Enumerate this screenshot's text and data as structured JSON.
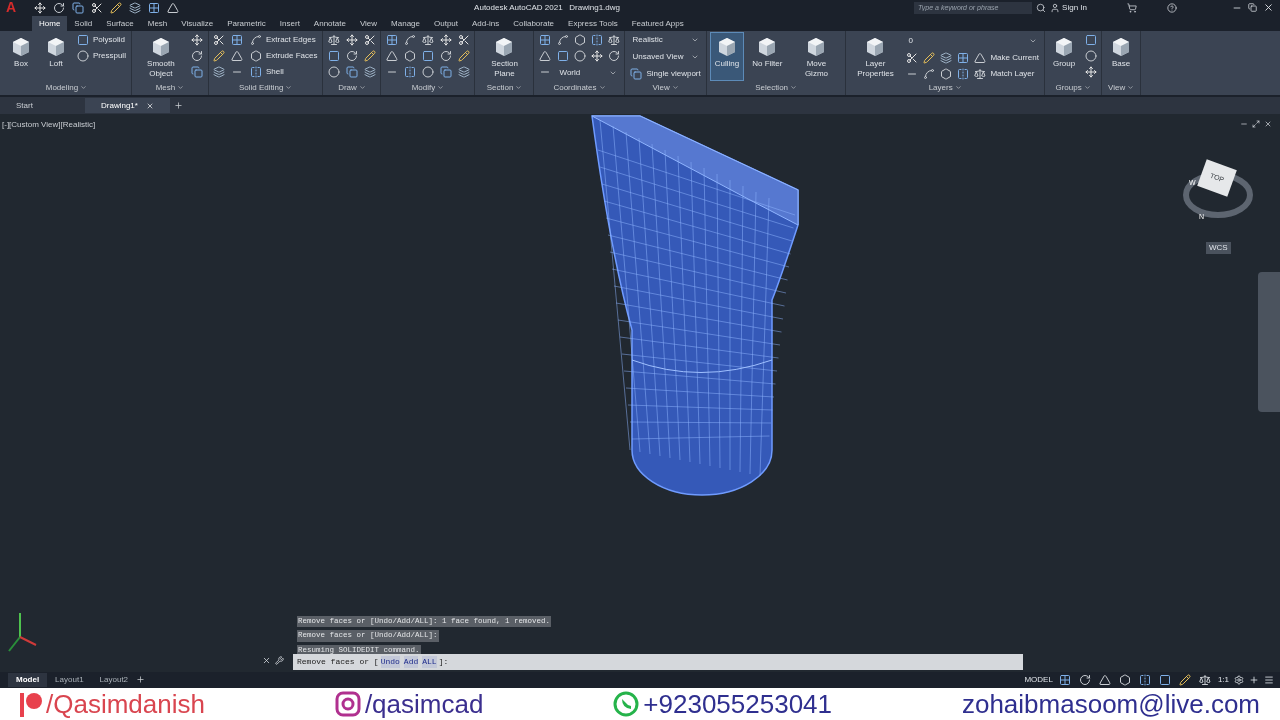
{
  "title_bar": {
    "logo": "A",
    "title": "Autodesk AutoCAD 2021",
    "document": "Drawing1.dwg",
    "search": {
      "placeholder": "Type a keyword or phrase"
    },
    "sign_in": "Sign In"
  },
  "ribbon_tabs": [
    {
      "label": "Home",
      "selected": true
    },
    {
      "label": "Solid",
      "selected": false
    },
    {
      "label": "Surface",
      "selected": false
    },
    {
      "label": "Mesh",
      "selected": false
    },
    {
      "label": "Visualize",
      "selected": false
    },
    {
      "label": "Parametric",
      "selected": false
    },
    {
      "label": "Insert",
      "selected": false
    },
    {
      "label": "Annotate",
      "selected": false
    },
    {
      "label": "View",
      "selected": false
    },
    {
      "label": "Manage",
      "selected": false
    },
    {
      "label": "Output",
      "selected": false
    },
    {
      "label": "Add-ins",
      "selected": false
    },
    {
      "label": "Collaborate",
      "selected": false
    },
    {
      "label": "Express Tools",
      "selected": false
    },
    {
      "label": "Featured Apps",
      "selected": false
    }
  ],
  "panels": [
    {
      "title": "Modeling",
      "columns": [
        [
          {
            "kind": "large",
            "label": "Box"
          }
        ],
        [
          {
            "kind": "large",
            "label": "Loft"
          }
        ],
        [
          {
            "kind": "small",
            "label": "Polysolid"
          },
          {
            "kind": "small",
            "label": "Presspull"
          }
        ]
      ]
    },
    {
      "title": "Mesh",
      "columns": [
        [
          {
            "kind": "large",
            "label": "Smooth Object"
          }
        ],
        [
          {
            "kind": "icon"
          },
          {
            "kind": "icon"
          },
          {
            "kind": "icon"
          }
        ]
      ]
    },
    {
      "title": "Solid Editing",
      "columns": [
        [
          {
            "kind": "icon"
          },
          {
            "kind": "icon"
          },
          {
            "kind": "icon"
          }
        ],
        [
          {
            "kind": "icon"
          },
          {
            "kind": "icon"
          },
          {
            "kind": "icon"
          }
        ],
        [
          {
            "kind": "small",
            "label": "Extract Edges"
          },
          {
            "kind": "small",
            "label": "Extrude Faces"
          },
          {
            "kind": "small",
            "label": "Shell"
          }
        ]
      ]
    },
    {
      "title": "Draw",
      "columns": [
        [
          {
            "kind": "icon"
          },
          {
            "kind": "icon"
          },
          {
            "kind": "icon"
          }
        ],
        [
          {
            "kind": "icon"
          },
          {
            "kind": "icon"
          },
          {
            "kind": "icon"
          }
        ],
        [
          {
            "kind": "icon"
          },
          {
            "kind": "icon"
          },
          {
            "kind": "icon"
          }
        ]
      ]
    },
    {
      "title": "Modify",
      "columns": [
        [
          {
            "kind": "icon"
          },
          {
            "kind": "icon"
          },
          {
            "kind": "icon"
          }
        ],
        [
          {
            "kind": "icon"
          },
          {
            "kind": "icon"
          },
          {
            "kind": "icon"
          }
        ],
        [
          {
            "kind": "icon"
          },
          {
            "kind": "icon"
          },
          {
            "kind": "icon"
          }
        ],
        [
          {
            "kind": "icon"
          },
          {
            "kind": "icon"
          },
          {
            "kind": "icon"
          }
        ],
        [
          {
            "kind": "icon"
          },
          {
            "kind": "icon"
          },
          {
            "kind": "icon"
          }
        ]
      ]
    },
    {
      "title": "Section",
      "columns": [
        [
          {
            "kind": "large",
            "label": "Section Plane"
          }
        ]
      ]
    },
    {
      "title": "Coordinates",
      "columns": [
        [
          {
            "kind": "icon"
          },
          {
            "kind": "icon"
          },
          {
            "kind": "icon"
          }
        ],
        [
          {
            "kind": "row",
            "items": [
              {
                "kind": "icon"
              },
              {
                "kind": "icon"
              },
              {
                "kind": "icon"
              },
              {
                "kind": "icon"
              }
            ]
          },
          {
            "kind": "row",
            "items": [
              {
                "kind": "icon"
              },
              {
                "kind": "icon"
              },
              {
                "kind": "icon"
              },
              {
                "kind": "icon"
              }
            ]
          },
          {
            "kind": "dropdown",
            "label": "World"
          }
        ]
      ]
    },
    {
      "title": "View",
      "columns": [
        [
          {
            "kind": "dropdown",
            "label": "Realistic"
          },
          {
            "kind": "dropdown",
            "label": "Unsaved View"
          },
          {
            "kind": "small",
            "label": "Single viewport"
          }
        ]
      ]
    },
    {
      "title": "Selection",
      "columns": [
        [
          {
            "kind": "large",
            "label": "Culling",
            "selected": true
          }
        ],
        [
          {
            "kind": "large",
            "label": "No Filter",
            "selected": false
          }
        ],
        [
          {
            "kind": "large",
            "label": "Move Gizmo",
            "selected": false
          }
        ]
      ]
    },
    {
      "title": "Layers",
      "columns": [
        [
          {
            "kind": "large",
            "label": "Layer Properties"
          }
        ],
        [
          {
            "kind": "dropdown",
            "label": "0"
          },
          {
            "kind": "row",
            "items": [
              {
                "kind": "icon"
              },
              {
                "kind": "icon"
              },
              {
                "kind": "icon"
              },
              {
                "kind": "icon"
              },
              {
                "kind": "small",
                "label": "Make Current"
              }
            ]
          },
          {
            "kind": "row",
            "items": [
              {
                "kind": "icon"
              },
              {
                "kind": "icon"
              },
              {
                "kind": "icon"
              },
              {
                "kind": "icon"
              },
              {
                "kind": "small",
                "label": "Match Layer"
              }
            ]
          }
        ]
      ]
    },
    {
      "title": "Groups",
      "columns": [
        [
          {
            "kind": "large",
            "label": "Group"
          }
        ],
        [
          {
            "kind": "icon"
          },
          {
            "kind": "icon"
          },
          {
            "kind": "icon"
          }
        ]
      ]
    },
    {
      "title": "View",
      "columns": [
        [
          {
            "kind": "large",
            "label": "Base"
          }
        ]
      ]
    }
  ],
  "file_tabs": [
    {
      "label": "Start",
      "selected": false
    },
    {
      "label": "Drawing1*",
      "selected": true
    }
  ],
  "viewport": {
    "label": "[-][Custom View][Realistic]",
    "viewcube": {
      "face": "TOP",
      "north": "N",
      "west": "W",
      "ucs": "WCS"
    }
  },
  "command_history": [
    "Remove faces or [Undo/Add/ALL]: 1 face found, 1 removed.",
    "Remove faces or [Undo/Add/ALL]:",
    "Resuming SOLIDEDIT command."
  ],
  "command_line": {
    "prompt": "Remove faces or [",
    "options": [
      "Undo",
      "Add",
      "ALL"
    ],
    "end": "]:"
  },
  "layout_tabs": [
    {
      "label": "Model",
      "selected": true
    },
    {
      "label": "Layout1",
      "selected": false
    },
    {
      "label": "Layout2",
      "selected": false
    }
  ],
  "status_bar": {
    "mode": "MODEL",
    "scale": "1:1"
  },
  "banner": [
    {
      "kind": "patreon",
      "text": "/Qasimdanish"
    },
    {
      "kind": "instagram",
      "text": "/qasimcad"
    },
    {
      "kind": "whatsapp",
      "text": "+923055253041"
    },
    {
      "kind": "email",
      "text": "zohaibmasoom@live.com"
    }
  ]
}
